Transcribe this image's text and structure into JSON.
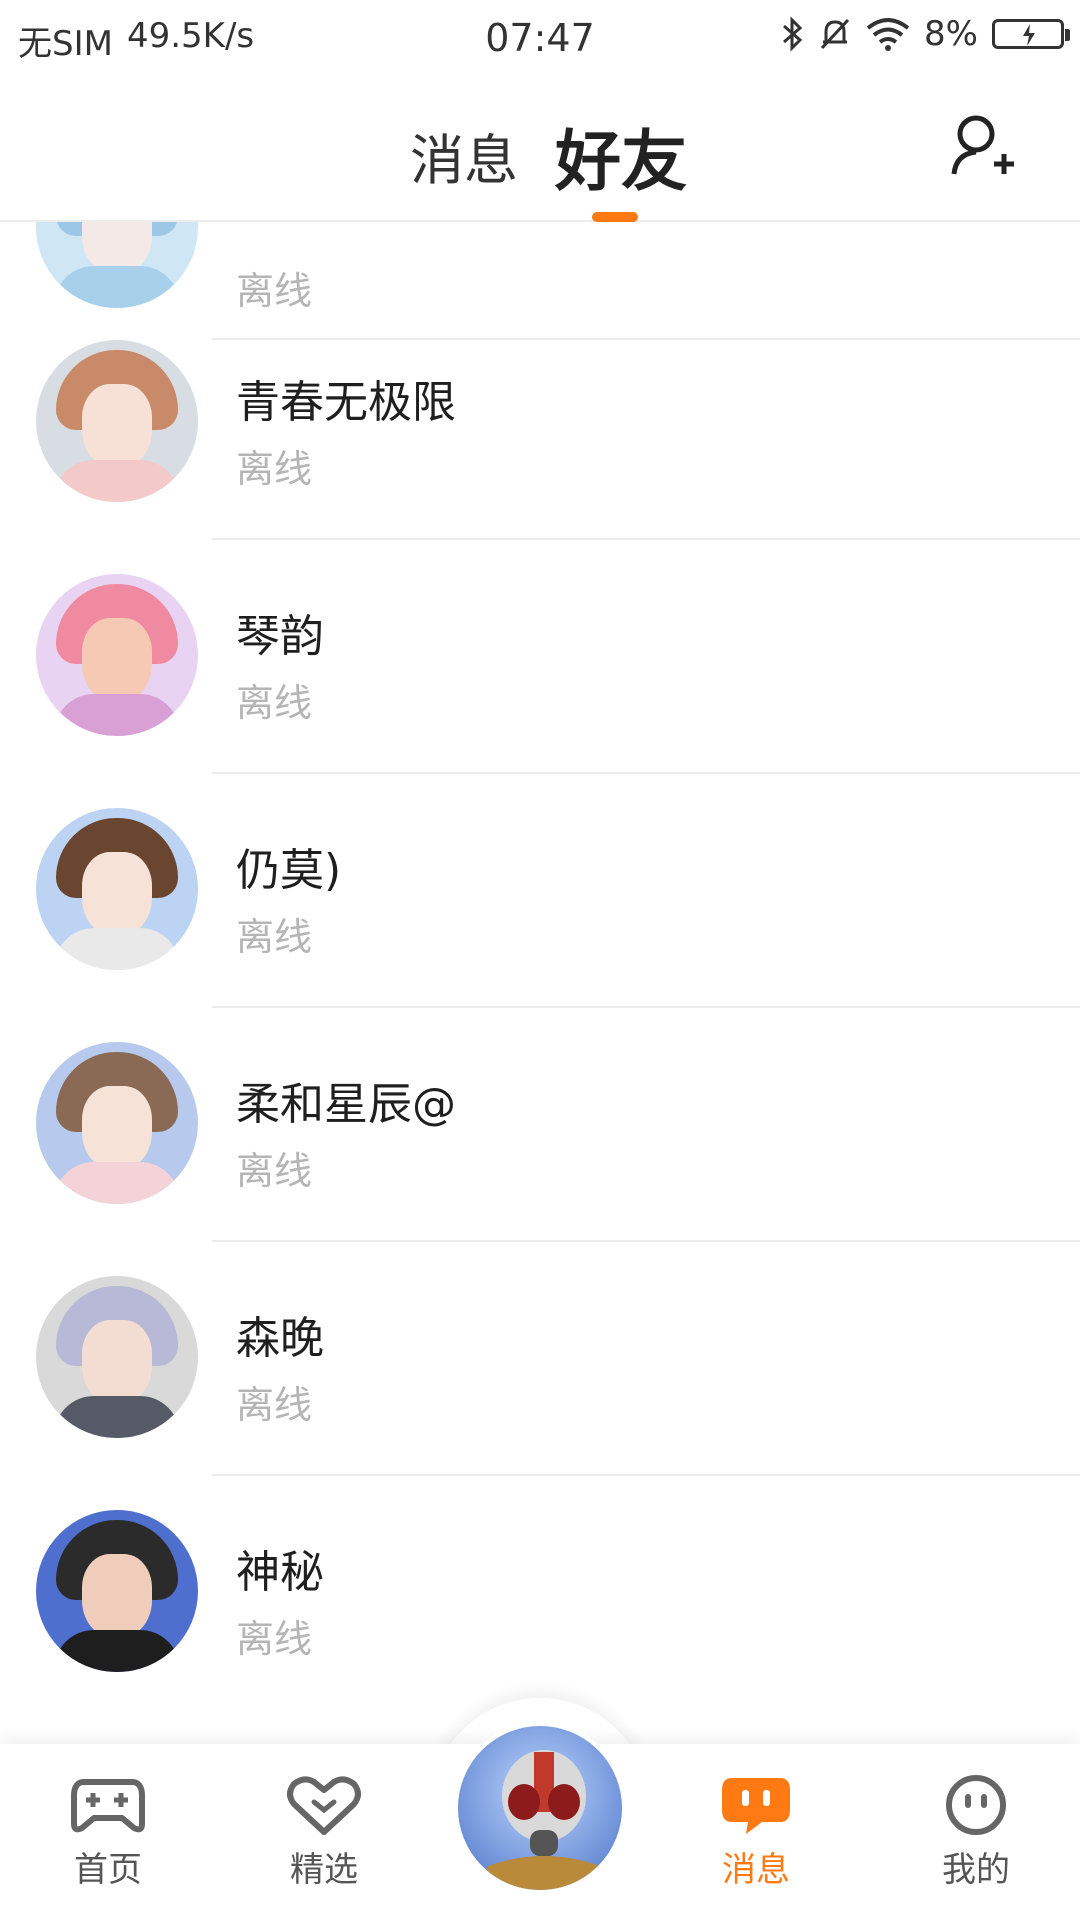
{
  "status_bar": {
    "carrier": "无SIM",
    "speed": "49.5K/s",
    "time": "07:47",
    "battery": "8%"
  },
  "header": {
    "tab_messages": "消息",
    "tab_friends": "好友",
    "add_friend_icon": "add-user-icon",
    "accent_color": "#ff7a12"
  },
  "friends": [
    {
      "name": "",
      "status": "离线"
    },
    {
      "name": "青春无极限",
      "status": "离线"
    },
    {
      "name": "琴韵",
      "status": "离线"
    },
    {
      "name": "仍莫)",
      "status": "离线"
    },
    {
      "name": "柔和星辰@",
      "status": "离线"
    },
    {
      "name": "森晚",
      "status": "离线"
    },
    {
      "name": "神秘",
      "status": "离线"
    }
  ],
  "bottom_nav": {
    "home": {
      "label": "首页",
      "icon": "gamepad-icon"
    },
    "featured": {
      "label": "精选",
      "icon": "heart-chat-icon"
    },
    "messages": {
      "label": "消息",
      "icon": "chat-bubble-icon"
    },
    "mine": {
      "label": "我的",
      "icon": "smiley-icon"
    }
  }
}
